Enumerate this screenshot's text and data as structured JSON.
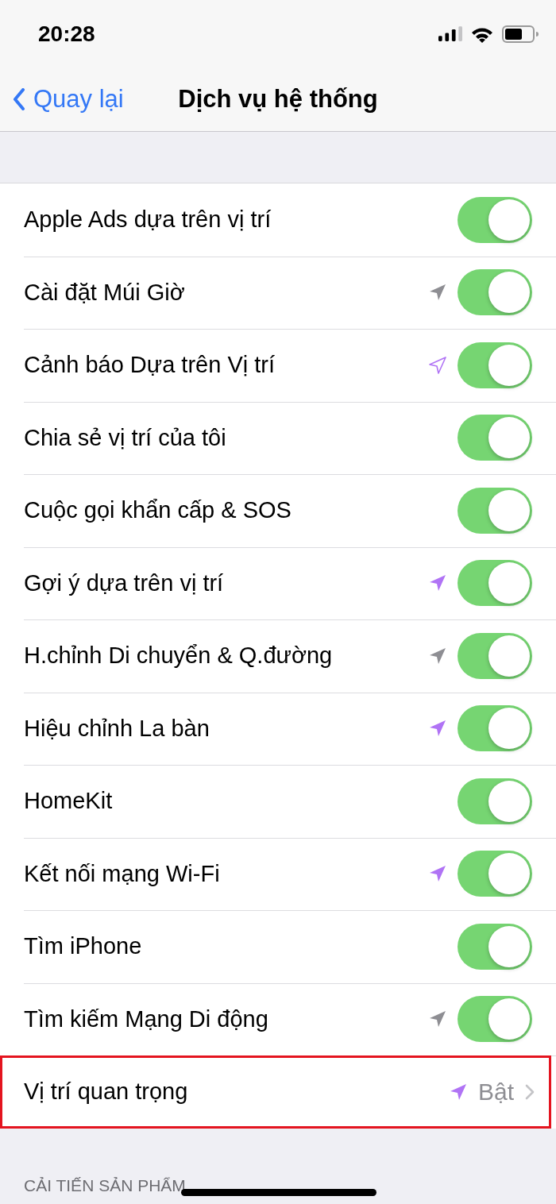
{
  "status_bar": {
    "time": "20:28"
  },
  "nav": {
    "back": "Quay lại",
    "title": "Dịch vụ hệ thống"
  },
  "rows": [
    {
      "kind": "toggle",
      "label": "Apple Ads dựa trên vị trí",
      "on": true
    },
    {
      "kind": "toggle",
      "label": "Cài đặt Múi Giờ",
      "on": true,
      "location": {
        "color": "#8e8e93",
        "filled": true
      }
    },
    {
      "kind": "toggle",
      "label": "Cảnh báo Dựa trên Vị trí",
      "on": true,
      "location": {
        "color": "#b073f5",
        "filled": false
      }
    },
    {
      "kind": "toggle",
      "label": "Chia sẻ vị trí của tôi",
      "on": true
    },
    {
      "kind": "toggle",
      "label": "Cuộc gọi khẩn cấp & SOS",
      "on": true
    },
    {
      "kind": "toggle",
      "label": "Gợi ý dựa trên vị trí",
      "on": true,
      "location": {
        "color": "#b073f5",
        "filled": true
      }
    },
    {
      "kind": "toggle",
      "label": "H.chỉnh Di chuyển & Q.đường",
      "on": true,
      "location": {
        "color": "#8e8e93",
        "filled": true
      }
    },
    {
      "kind": "toggle",
      "label": "Hiệu chỉnh La bàn",
      "on": true,
      "location": {
        "color": "#b073f5",
        "filled": true
      }
    },
    {
      "kind": "toggle",
      "label": "HomeKit",
      "on": true
    },
    {
      "kind": "toggle",
      "label": "Kết nối mạng Wi-Fi",
      "on": true,
      "location": {
        "color": "#b073f5",
        "filled": true
      }
    },
    {
      "kind": "toggle",
      "label": "Tìm iPhone",
      "on": true
    },
    {
      "kind": "toggle",
      "label": "Tìm kiếm Mạng Di động",
      "on": true,
      "location": {
        "color": "#8e8e93",
        "filled": true
      }
    },
    {
      "kind": "detail",
      "label": "Vị trí quan trọng",
      "value": "Bật",
      "location": {
        "color": "#b073f5",
        "filled": true
      },
      "highlighted": true
    }
  ],
  "section_header": "CẢI TIẾN SẢN PHẨM"
}
